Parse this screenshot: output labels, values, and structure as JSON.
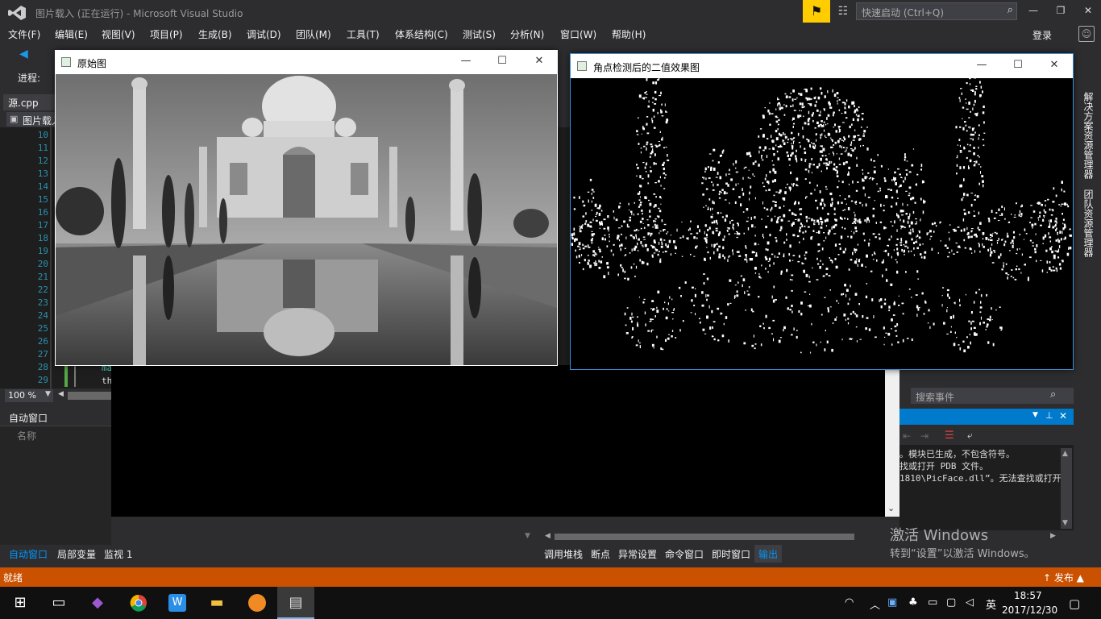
{
  "titlebar": {
    "title": "图片载入 (正在运行) - Microsoft Visual Studio",
    "quick_launch_placeholder": "快速启动 (Ctrl+Q)"
  },
  "menu": [
    "文件(F)",
    "编辑(E)",
    "视图(V)",
    "项目(P)",
    "生成(B)",
    "调试(D)",
    "团队(M)",
    "工具(T)",
    "体系结构(C)",
    "测试(S)",
    "分析(N)",
    "窗口(W)",
    "帮助(H)"
  ],
  "signin": "登录",
  "toolbar": {
    "progress_label": "进程:"
  },
  "editor": {
    "tab": "源.cpp",
    "nav_combo": "图片载入",
    "line_numbers": [
      "10",
      "11",
      "12",
      "13",
      "14",
      "15",
      "16",
      "17",
      "18",
      "19",
      "20",
      "21",
      "22",
      "23",
      "24",
      "25",
      "26",
      "27",
      "28",
      "29"
    ],
    "code_line_28": "ma",
    "code_line_29": "th",
    "zoom": "100 %"
  },
  "autos": {
    "title": "自动窗口",
    "column_name": "名称"
  },
  "bottom_tabs_left": [
    "自动窗口",
    "局部变量",
    "监视 1"
  ],
  "bottom_tabs_right": [
    "调用堆栈",
    "断点",
    "异常设置",
    "命令窗口",
    "即时窗口",
    "输出"
  ],
  "side_panels": [
    "解决方案资源管理器",
    "团队资源管理器"
  ],
  "diagnostics": {
    "search_placeholder": "搜索事件"
  },
  "output": {
    "lines": [
      "。模块已生成，不包含符号。",
      "找或打开 PDB 文件。",
      "1810\\PicFace.dll”。无法查找或打开"
    ]
  },
  "watermark": {
    "line1": "激活 Windows",
    "line2": "转到“设置”以激活 Windows。"
  },
  "statusbar": {
    "text": "就绪",
    "publish": "↑ 发布 ▲"
  },
  "window_original": {
    "title": "原始图"
  },
  "window_corner": {
    "title": "角点检测后的二值效果图"
  },
  "taskbar": {
    "time": "18:57",
    "date": "2017/12/30",
    "ime": "英"
  },
  "colors": {
    "vs_blue": "#007acc",
    "status_orange": "#ca5100",
    "notify_yellow": "#ffcc00"
  }
}
